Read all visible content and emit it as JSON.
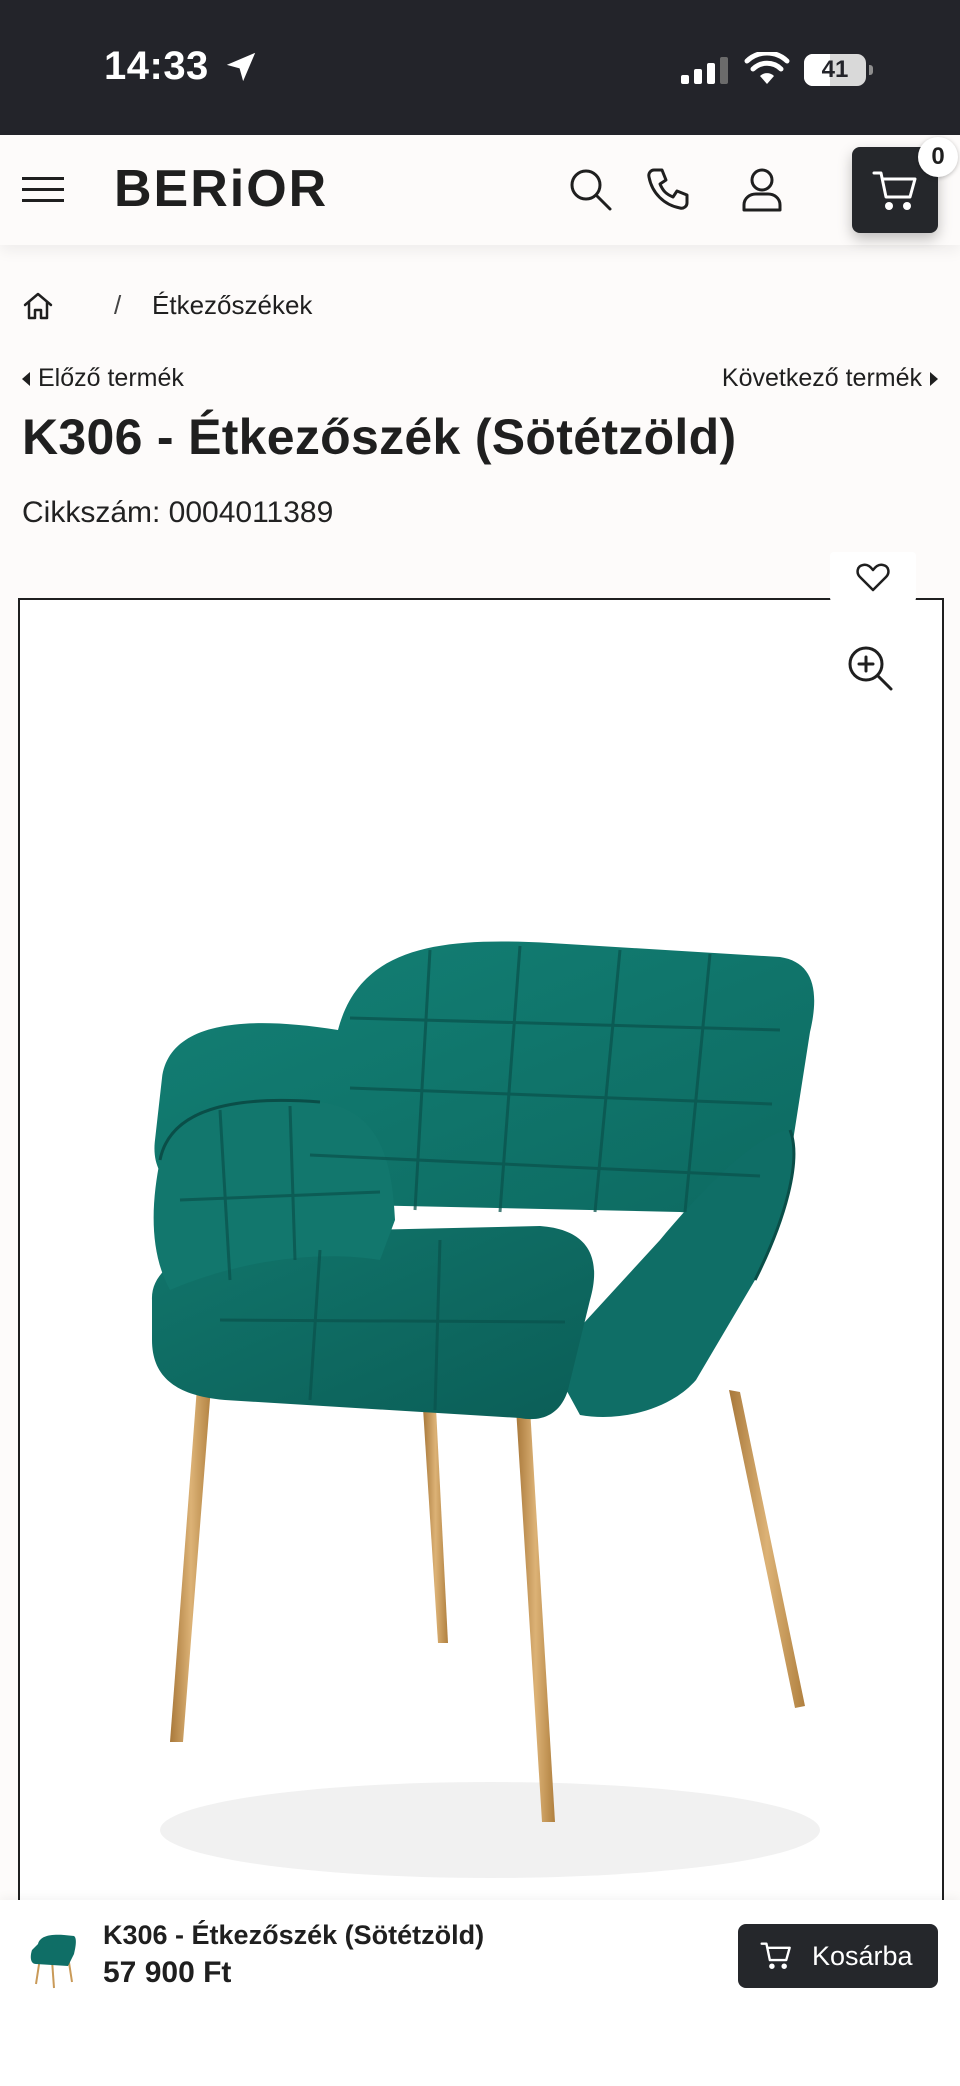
{
  "status_bar": {
    "time": "14:33",
    "battery": "41",
    "icons": [
      "location-arrow-icon",
      "cellular-signal-icon",
      "wifi-icon",
      "battery-icon"
    ]
  },
  "header": {
    "logo": "BERiOR",
    "cart_count": "0",
    "icons": [
      "menu-icon",
      "search-icon",
      "phone-icon",
      "user-icon",
      "cart-icon"
    ]
  },
  "breadcrumb": {
    "separator": "/",
    "category": "Étkezőszékek"
  },
  "nav": {
    "prev": "Előző termék",
    "next": "Következő termék"
  },
  "product": {
    "title": "K306 - Étkezőszék (Sötétzöld)",
    "sku": "Cikkszám: 0004011389"
  },
  "sticky": {
    "name": "K306 - Étkezőszék (Sötétzöld)",
    "price": "57 900 Ft",
    "button": "Kosárba"
  },
  "colors": {
    "dark": "#25272b",
    "status_bar": "#23242a",
    "chair_green": "#0e6b63",
    "leg_gold": "#c99a58",
    "background": "#fdfbfa"
  }
}
